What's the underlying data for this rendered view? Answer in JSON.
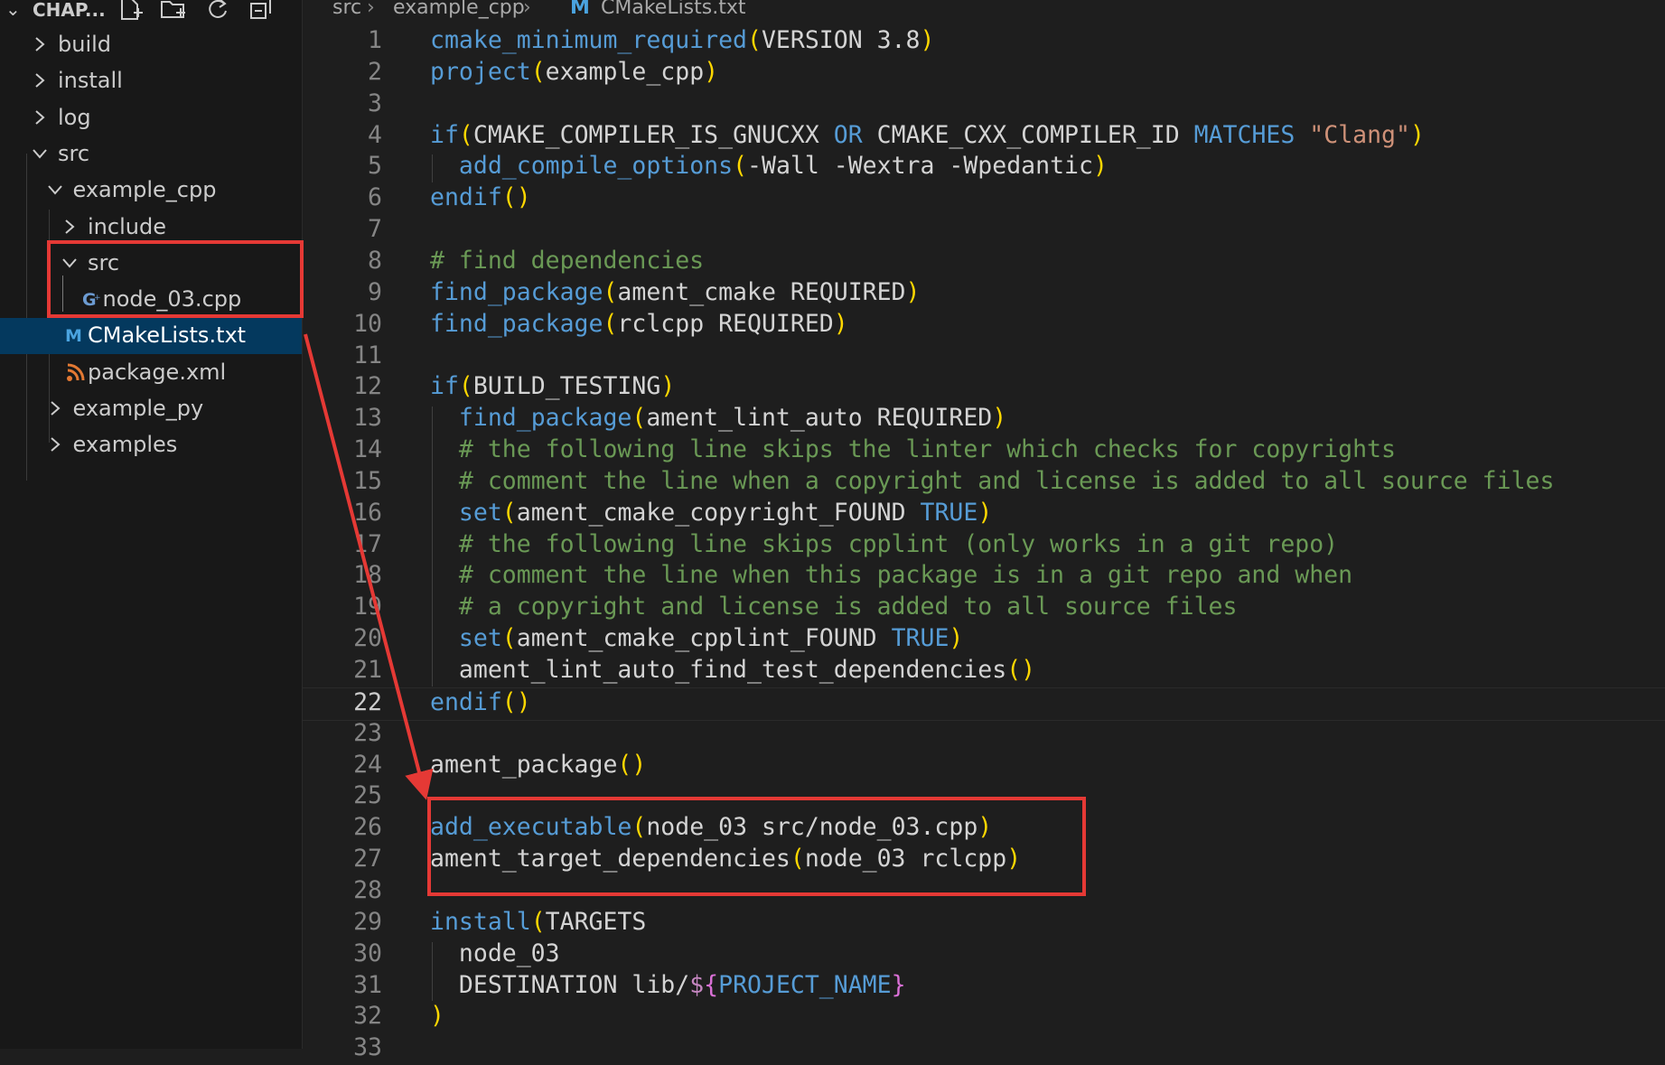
{
  "explorer": {
    "title": "CHAP...",
    "tree": [
      {
        "label": "build",
        "depth": 0,
        "type": "folder",
        "expanded": false
      },
      {
        "label": "install",
        "depth": 0,
        "type": "folder",
        "expanded": false
      },
      {
        "label": "log",
        "depth": 0,
        "type": "folder",
        "expanded": false
      },
      {
        "label": "src",
        "depth": 0,
        "type": "folder",
        "expanded": true
      },
      {
        "label": "example_cpp",
        "depth": 1,
        "type": "folder",
        "expanded": true
      },
      {
        "label": "include",
        "depth": 2,
        "type": "folder",
        "expanded": false
      },
      {
        "label": "src",
        "depth": 2,
        "type": "folder",
        "expanded": true
      },
      {
        "label": "node_03.cpp",
        "depth": 3,
        "type": "file",
        "icon": "cpp-file-icon"
      },
      {
        "label": "CMakeLists.txt",
        "depth": 2,
        "type": "file",
        "icon": "cmake-file-icon",
        "selected": true
      },
      {
        "label": "package.xml",
        "depth": 2,
        "type": "file",
        "icon": "rss-xml-file-icon"
      },
      {
        "label": "example_py",
        "depth": 1,
        "type": "folder",
        "expanded": false
      },
      {
        "label": "examples",
        "depth": 1,
        "type": "folder",
        "expanded": false
      }
    ]
  },
  "breadcrumb": {
    "items": [
      "src",
      "example_cpp",
      "CMakeLists.txt"
    ],
    "file_icon": "M"
  },
  "editor": {
    "active_line": 22,
    "lines": [
      {
        "n": "1",
        "tokens": [
          [
            "fn",
            "cmake_minimum_required"
          ],
          [
            "p1",
            "("
          ],
          [
            "tx",
            "VERSION 3.8"
          ],
          [
            "p1",
            ")"
          ]
        ]
      },
      {
        "n": "2",
        "tokens": [
          [
            "fn",
            "project"
          ],
          [
            "p1",
            "("
          ],
          [
            "tx",
            "example_cpp"
          ],
          [
            "p1",
            ")"
          ]
        ]
      },
      {
        "n": "3",
        "tokens": []
      },
      {
        "n": "4",
        "tokens": [
          [
            "kw",
            "if"
          ],
          [
            "p1",
            "("
          ],
          [
            "tx",
            "CMAKE_COMPILER_IS_GNUCXX "
          ],
          [
            "kw",
            "OR"
          ],
          [
            "tx",
            " CMAKE_CXX_COMPILER_ID "
          ],
          [
            "kw",
            "MATCHES"
          ],
          [
            "tx",
            " "
          ],
          [
            "str",
            "\"Clang\""
          ],
          [
            "p1",
            ")"
          ]
        ]
      },
      {
        "n": "5",
        "tokens": [
          [
            "tx",
            "  "
          ],
          [
            "fn",
            "add_compile_options"
          ],
          [
            "p1",
            "("
          ],
          [
            "tx",
            "-Wall -Wextra -Wpedantic"
          ],
          [
            "p1",
            ")"
          ]
        ]
      },
      {
        "n": "6",
        "tokens": [
          [
            "kw",
            "endif"
          ],
          [
            "p1",
            "()"
          ]
        ]
      },
      {
        "n": "7",
        "tokens": []
      },
      {
        "n": "8",
        "tokens": [
          [
            "cm",
            "# find dependencies"
          ]
        ]
      },
      {
        "n": "9",
        "tokens": [
          [
            "fn",
            "find_package"
          ],
          [
            "p1",
            "("
          ],
          [
            "tx",
            "ament_cmake REQUIRED"
          ],
          [
            "p1",
            ")"
          ]
        ]
      },
      {
        "n": "10",
        "tokens": [
          [
            "fn",
            "find_package"
          ],
          [
            "p1",
            "("
          ],
          [
            "tx",
            "rclcpp REQUIRED"
          ],
          [
            "p1",
            ")"
          ]
        ]
      },
      {
        "n": "11",
        "tokens": []
      },
      {
        "n": "12",
        "tokens": [
          [
            "kw",
            "if"
          ],
          [
            "p1",
            "("
          ],
          [
            "tx",
            "BUILD_TESTING"
          ],
          [
            "p1",
            ")"
          ]
        ]
      },
      {
        "n": "13",
        "tokens": [
          [
            "tx",
            "  "
          ],
          [
            "fn",
            "find_package"
          ],
          [
            "p1",
            "("
          ],
          [
            "tx",
            "ament_lint_auto REQUIRED"
          ],
          [
            "p1",
            ")"
          ]
        ]
      },
      {
        "n": "14",
        "tokens": [
          [
            "tx",
            "  "
          ],
          [
            "cm",
            "# the following line skips the linter which checks for copyrights"
          ]
        ]
      },
      {
        "n": "15",
        "tokens": [
          [
            "tx",
            "  "
          ],
          [
            "cm",
            "# comment the line when a copyright and license is added to all source files"
          ]
        ]
      },
      {
        "n": "16",
        "tokens": [
          [
            "tx",
            "  "
          ],
          [
            "fn",
            "set"
          ],
          [
            "p1",
            "("
          ],
          [
            "tx",
            "ament_cmake_copyright_FOUND "
          ],
          [
            "kw",
            "TRUE"
          ],
          [
            "p1",
            ")"
          ]
        ]
      },
      {
        "n": "17",
        "tokens": [
          [
            "tx",
            "  "
          ],
          [
            "cm",
            "# the following line skips cpplint (only works in a git repo)"
          ]
        ]
      },
      {
        "n": "18",
        "tokens": [
          [
            "tx",
            "  "
          ],
          [
            "cm",
            "# comment the line when this package is in a git repo and when"
          ]
        ]
      },
      {
        "n": "19",
        "tokens": [
          [
            "tx",
            "  "
          ],
          [
            "cm",
            "# a copyright and license is added to all source files"
          ]
        ]
      },
      {
        "n": "20",
        "tokens": [
          [
            "tx",
            "  "
          ],
          [
            "fn",
            "set"
          ],
          [
            "p1",
            "("
          ],
          [
            "tx",
            "ament_cmake_cpplint_FOUND "
          ],
          [
            "kw",
            "TRUE"
          ],
          [
            "p1",
            ")"
          ]
        ]
      },
      {
        "n": "21",
        "tokens": [
          [
            "tx",
            "  ament_lint_auto_find_test_dependencies"
          ],
          [
            "p1",
            "()"
          ]
        ]
      },
      {
        "n": "22",
        "tokens": [
          [
            "kw",
            "endif"
          ],
          [
            "p1",
            "()"
          ]
        ]
      },
      {
        "n": "23",
        "tokens": []
      },
      {
        "n": "24",
        "tokens": [
          [
            "tx",
            "ament_package"
          ],
          [
            "p1",
            "()"
          ]
        ]
      },
      {
        "n": "25",
        "tokens": []
      },
      {
        "n": "26",
        "tokens": [
          [
            "fn",
            "add_executable"
          ],
          [
            "p1",
            "("
          ],
          [
            "tx",
            "node_03 src/node_03.cpp"
          ],
          [
            "p1",
            ")"
          ]
        ]
      },
      {
        "n": "27",
        "tokens": [
          [
            "tx",
            "ament_target_dependencies"
          ],
          [
            "p1",
            "("
          ],
          [
            "tx",
            "node_03 rclcpp"
          ],
          [
            "p1",
            ")"
          ]
        ]
      },
      {
        "n": "28",
        "tokens": []
      },
      {
        "n": "29",
        "tokens": [
          [
            "fn",
            "install"
          ],
          [
            "p1",
            "("
          ],
          [
            "tx",
            "TARGETS"
          ]
        ]
      },
      {
        "n": "30",
        "tokens": [
          [
            "tx",
            "  node_03"
          ]
        ]
      },
      {
        "n": "31",
        "tokens": [
          [
            "tx",
            "  DESTINATION lib/"
          ],
          [
            "dollar",
            "$"
          ],
          [
            "p2",
            "{"
          ],
          [
            "var",
            "PROJECT_NAME"
          ],
          [
            "p2",
            "}"
          ]
        ]
      },
      {
        "n": "32",
        "tokens": [
          [
            "p1",
            ")"
          ]
        ]
      },
      {
        "n": "33",
        "tokens": []
      }
    ]
  },
  "colors": {
    "annotation": "#e53935",
    "selection": "#04395e",
    "keyword": "#569cd6",
    "string": "#ce9178",
    "comment": "#6a9955",
    "bracket": "#ffd700"
  }
}
